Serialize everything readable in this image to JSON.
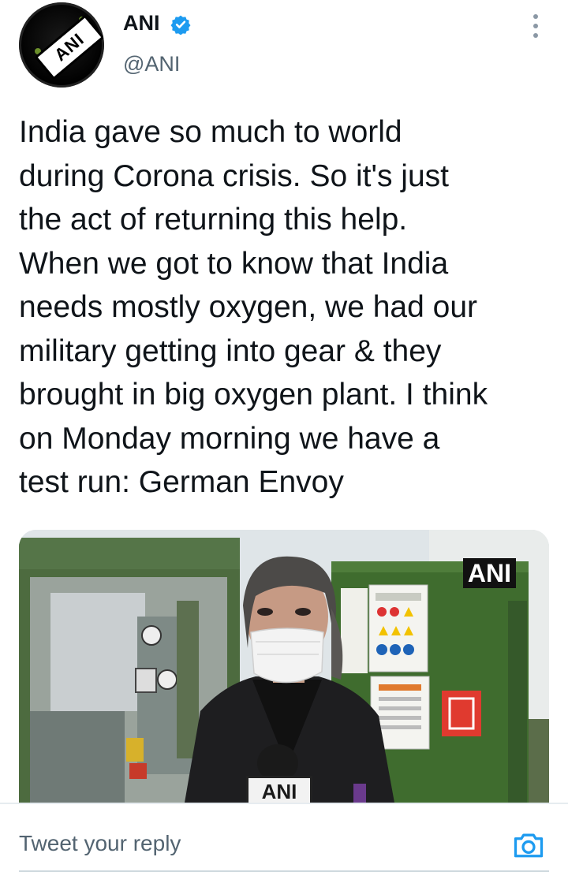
{
  "author": {
    "display_name": "ANI",
    "handle": "@ANI",
    "avatar_text": "ANI",
    "verified": true
  },
  "tweet": {
    "text": "India gave so much to world\nduring Corona crisis. So it's just\nthe act of returning this help.\nWhen we got to know that India\nneeds mostly oxygen, we had our\nmilitary getting into gear & they\nbrought in big oxygen plant. I think\non Monday morning we have a\ntest run: German Envoy"
  },
  "media": {
    "watermark": "ANI",
    "mic_label": "ANI"
  },
  "reply": {
    "placeholder": "Tweet your reply"
  },
  "icons": {
    "more": "more-vertical-icon",
    "verified": "verified-badge-icon",
    "camera": "camera-icon"
  },
  "colors": {
    "text": "#0f1419",
    "secondary": "#536471",
    "accent": "#1d9bf0"
  }
}
